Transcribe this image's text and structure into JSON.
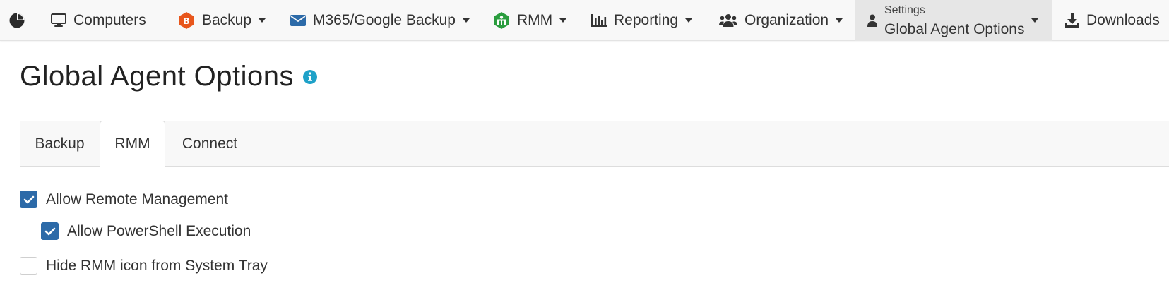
{
  "nav": {
    "items": [
      {
        "label": "Computers",
        "icon": "monitor-icon",
        "dropdown": false
      },
      {
        "label": "Backup",
        "icon": "backup-logo-icon",
        "dropdown": true,
        "icon_color": "#e8561c"
      },
      {
        "label": "M365/Google Backup",
        "icon": "envelope-icon",
        "dropdown": true,
        "icon_color": "#2c6aa8"
      },
      {
        "label": "RMM",
        "icon": "rmm-logo-icon",
        "dropdown": true,
        "icon_color": "#2a9d3e"
      },
      {
        "label": "Reporting",
        "icon": "bar-chart-icon",
        "dropdown": true
      },
      {
        "label": "Organization",
        "icon": "users-icon",
        "dropdown": true
      }
    ],
    "settings": {
      "small_label": "Settings",
      "label": "Global Agent Options"
    },
    "downloads": {
      "label": "Downloads"
    }
  },
  "page": {
    "title": "Global Agent Options"
  },
  "tabs": [
    {
      "label": "Backup",
      "active": false
    },
    {
      "label": "RMM",
      "active": true
    },
    {
      "label": "Connect",
      "active": false
    }
  ],
  "options": [
    {
      "label": "Allow Remote Management",
      "checked": true
    },
    {
      "label": "Allow PowerShell Execution",
      "checked": true
    },
    {
      "label": "Hide RMM icon from System Tray",
      "checked": false
    }
  ],
  "colors": {
    "accent": "#2c6aa8",
    "info": "#1ea1c8",
    "active_nav_bg": "#e6e6e6"
  }
}
